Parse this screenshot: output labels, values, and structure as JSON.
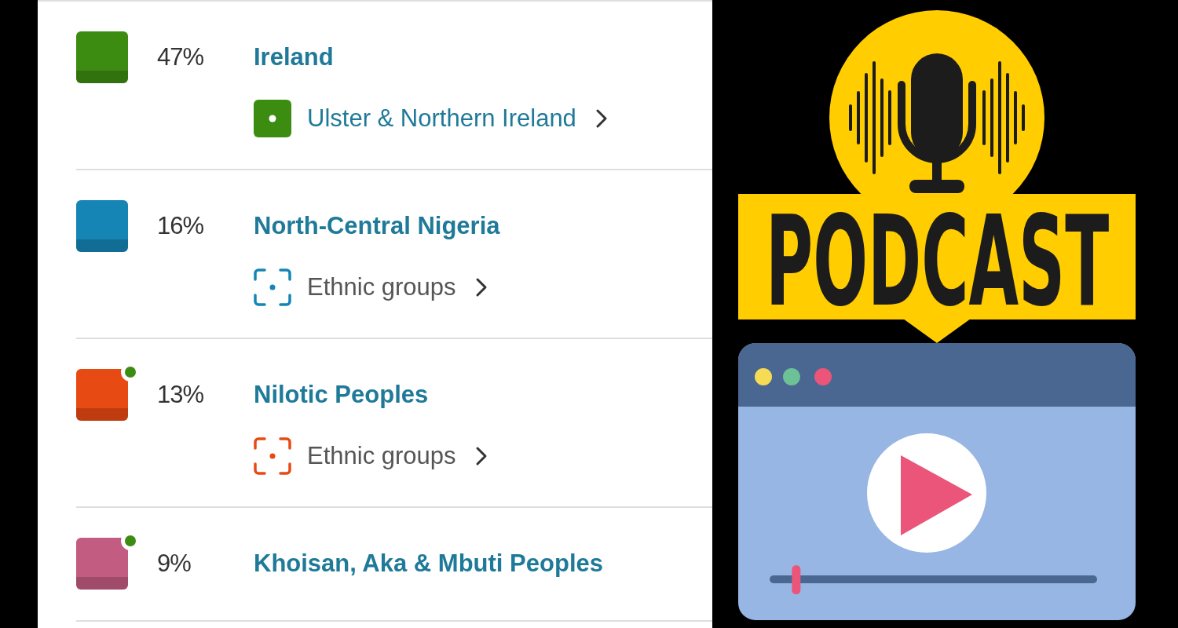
{
  "ancestry_list": [
    {
      "percent": "47%",
      "name": "Ireland",
      "color": "#3c8c12",
      "new": false,
      "sub": {
        "kind": "region",
        "label": "Ulster & Northern Ireland",
        "color": "#3c8c12"
      }
    },
    {
      "percent": "16%",
      "name": "North-Central Nigeria",
      "color": "#1585b5",
      "new": false,
      "sub": {
        "kind": "ethnic_groups",
        "label": "Ethnic groups",
        "color": "#1585b5"
      }
    },
    {
      "percent": "13%",
      "name": "Nilotic Peoples",
      "color": "#e84a14",
      "new": true,
      "sub": {
        "kind": "ethnic_groups",
        "label": "Ethnic groups",
        "color": "#e84a14"
      }
    },
    {
      "percent": "9%",
      "name": "Khoisan, Aka & Mbuti Peoples",
      "color": "#c25c80",
      "new": true
    }
  ],
  "podcast_graphic": {
    "title": "PODCAST",
    "player": {
      "level": 0.08
    }
  }
}
